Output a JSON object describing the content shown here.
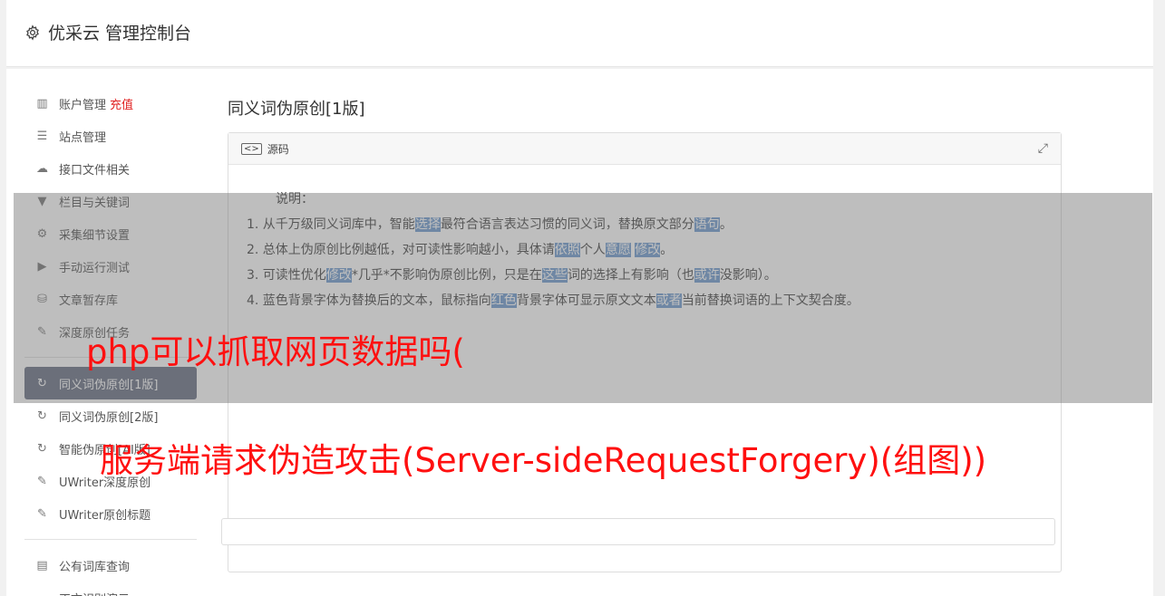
{
  "header": {
    "title": "优采云 管理控制台"
  },
  "sidebar": {
    "group1": [
      {
        "label": "账户管理",
        "icon": "bar-chart-icon",
        "extra": "充值"
      },
      {
        "label": "站点管理",
        "icon": "server-icon"
      },
      {
        "label": "接口文件相关",
        "icon": "cloud-upload-icon"
      },
      {
        "label": "栏目与关键词",
        "icon": "filter-icon"
      },
      {
        "label": "采集细节设置",
        "icon": "cogs-icon"
      },
      {
        "label": "手动运行测试",
        "icon": "play-circle-icon"
      },
      {
        "label": "文章暂存库",
        "icon": "database-icon"
      },
      {
        "label": "深度原创任务",
        "icon": "edit-icon"
      }
    ],
    "group2": [
      {
        "label": "同义词伪原创[1版]",
        "icon": "refresh-icon",
        "active": true
      },
      {
        "label": "同义词伪原创[2版]",
        "icon": "refresh-icon"
      },
      {
        "label": "智能伪原创[AI版]",
        "icon": "refresh-icon"
      },
      {
        "label": "UWriter深度原创",
        "icon": "edit-icon"
      },
      {
        "label": "UWriter原创标题",
        "icon": "edit-icon"
      }
    ],
    "group3": [
      {
        "label": "公有词库查询",
        "icon": "book-icon"
      },
      {
        "label": "正文识别演示",
        "icon": "desktop-icon"
      }
    ]
  },
  "main": {
    "title": "同义词伪原创[1版]",
    "panel": {
      "header": "源码",
      "say": "说明：",
      "lines": [
        [
          {
            "t": "1. 从千万级同义词库中，智能"
          },
          {
            "t": "选择",
            "h": true
          },
          {
            "t": "最符合语言表达习惯的同义词，替换原文部分"
          },
          {
            "t": "语句",
            "h": true
          },
          {
            "t": "。"
          }
        ],
        [
          {
            "t": "2. 总体上伪原创比例越低，对可读性影响越小，具体请"
          },
          {
            "t": "依照",
            "h": true
          },
          {
            "t": "个人"
          },
          {
            "t": "意愿",
            "h": true
          },
          {
            "t": " "
          },
          {
            "t": "修改",
            "h": true
          },
          {
            "t": "。"
          }
        ],
        [
          {
            "t": "3. 可读性优化"
          },
          {
            "t": "修改",
            "h": true
          },
          {
            "t": "*几乎*不影响伪原创比例，只是在"
          },
          {
            "t": "这些",
            "h": true
          },
          {
            "t": "词的选择上有影响（也"
          },
          {
            "t": "或许",
            "h": true
          },
          {
            "t": "没影响）。"
          }
        ],
        [
          {
            "t": "4. 蓝色背景字体为替换后的文本，鼠标指向"
          },
          {
            "t": "红色",
            "h": true
          },
          {
            "t": "背景字体可显示原文文本"
          },
          {
            "t": "或者",
            "h": true
          },
          {
            "t": "当前替换词语的上下文契合度。"
          }
        ]
      ]
    }
  },
  "overlay": {
    "line1": "php可以抓取网页数据吗(",
    "line2": "服务端请求伪造攻击(Server-sideRequestForgery)(组图))"
  }
}
